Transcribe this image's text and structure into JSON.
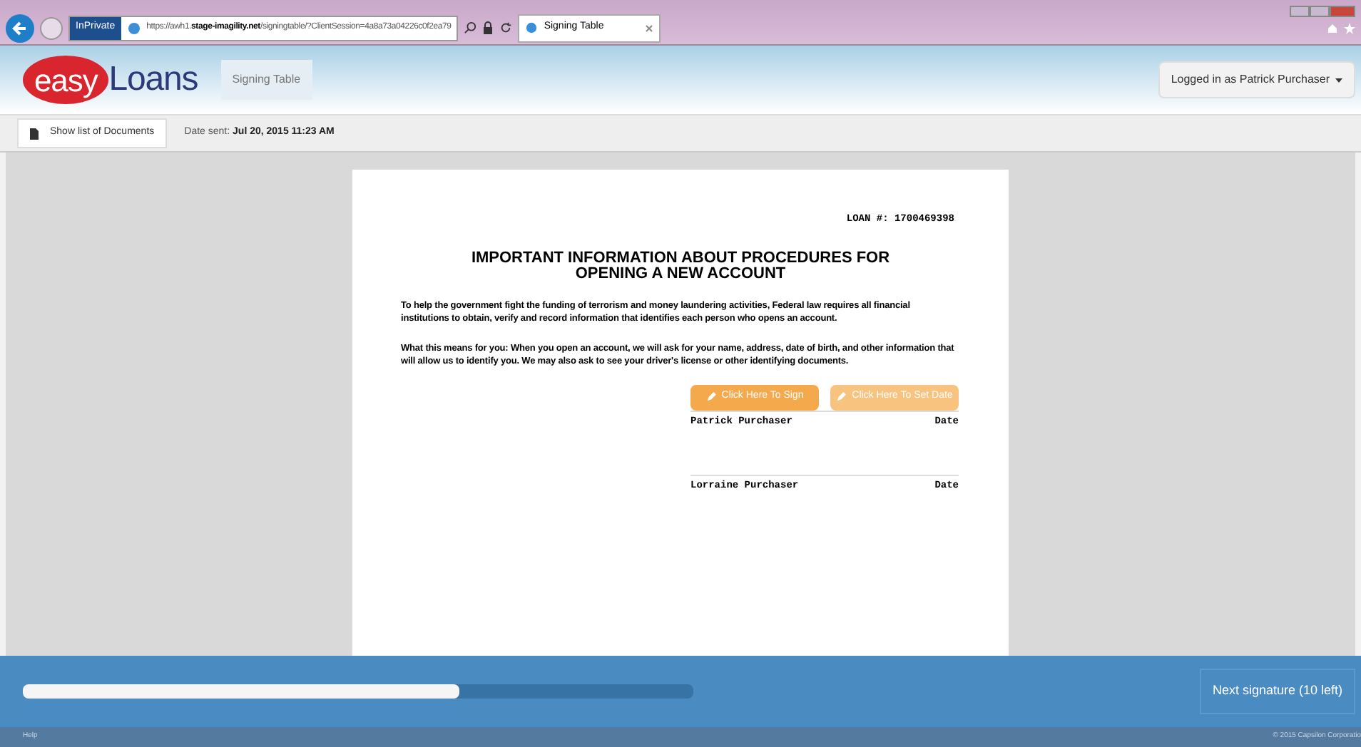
{
  "browser": {
    "private_badge": "InPrivate",
    "url_prefix": "https://awh1.",
    "url_domain": "stage-imagility.net",
    "url_path": "/signingtable/?ClientSession=4a8a73a04226c0f2ea79",
    "tab_title": "Signing Table"
  },
  "header": {
    "logo_part_1": "easy",
    "logo_part_2": "Loans",
    "nav_item": "Signing Table",
    "user_menu": "Logged in as Patrick Purchaser"
  },
  "toolbar": {
    "documents_button": "Show list of Documents",
    "date_label": "Date sent:",
    "date_value": "Jul 20, 2015 11:23 AM"
  },
  "document": {
    "loan_number": "LOAN #: 1700469398",
    "title_line_1": "IMPORTANT INFORMATION ABOUT PROCEDURES FOR",
    "title_line_2": "OPENING A NEW ACCOUNT",
    "paragraphs": [
      "To help the government fight the funding of terrorism and money laundering activities, Federal law requires all financial institutions to obtain, verify and record information that identifies each person who opens an account.",
      "What this means for you: When you open an account, we will ask for your name, address, date of birth, and other information that will allow us to identify you. We may also ask to see your driver's license or other identifying documents."
    ],
    "action_buttons": [
      {
        "label": "Click Here To Sign",
        "disabled": false
      },
      {
        "label": "Click Here To Set Date",
        "disabled": true
      }
    ],
    "signers": [
      {
        "name": "Patrick Purchaser",
        "date_label": "Date"
      },
      {
        "name": "Lorraine Purchaser",
        "date_label": "Date"
      }
    ]
  },
  "progress": {
    "level": 0.65,
    "next_button": "Next signature (10 left)"
  },
  "footer": {
    "help": "Help",
    "copyright": "© 2015 Capsilon Corporatio"
  }
}
